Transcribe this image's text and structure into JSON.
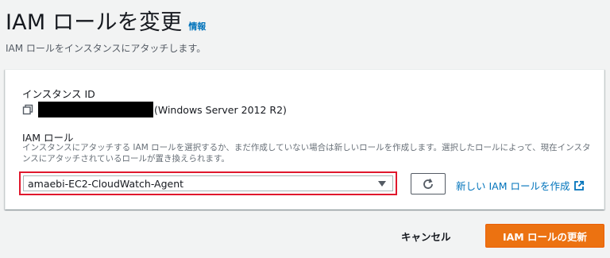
{
  "header": {
    "title": "IAM ロールを変更",
    "info_link": "情報",
    "subtitle": "IAM ロールをインスタンスにアタッチします。"
  },
  "instance": {
    "label": "インスタンス ID",
    "id_redacted": true,
    "os": "(Windows Server 2012 R2)",
    "copy_icon": "copy-icon"
  },
  "role": {
    "label": "IAM ロール",
    "description": "インスタンスにアタッチする IAM ロールを選択するか、まだ作成していない場合は新しいロールを作成します。選択したロールによって、現在インスタンスにアタッチされているロールが置き換えられます。",
    "selected": "amaebi-EC2-CloudWatch-Agent",
    "refresh_icon": "refresh-icon",
    "create_link": "新しい IAM ロールを作成",
    "external_icon": "external-link-icon"
  },
  "actions": {
    "cancel": "キャンセル",
    "submit": "IAM ロールの更新"
  },
  "colors": {
    "primary": "#ec7211",
    "link": "#0073bb",
    "highlight": "#e0182d",
    "background": "#f2f3f3"
  }
}
